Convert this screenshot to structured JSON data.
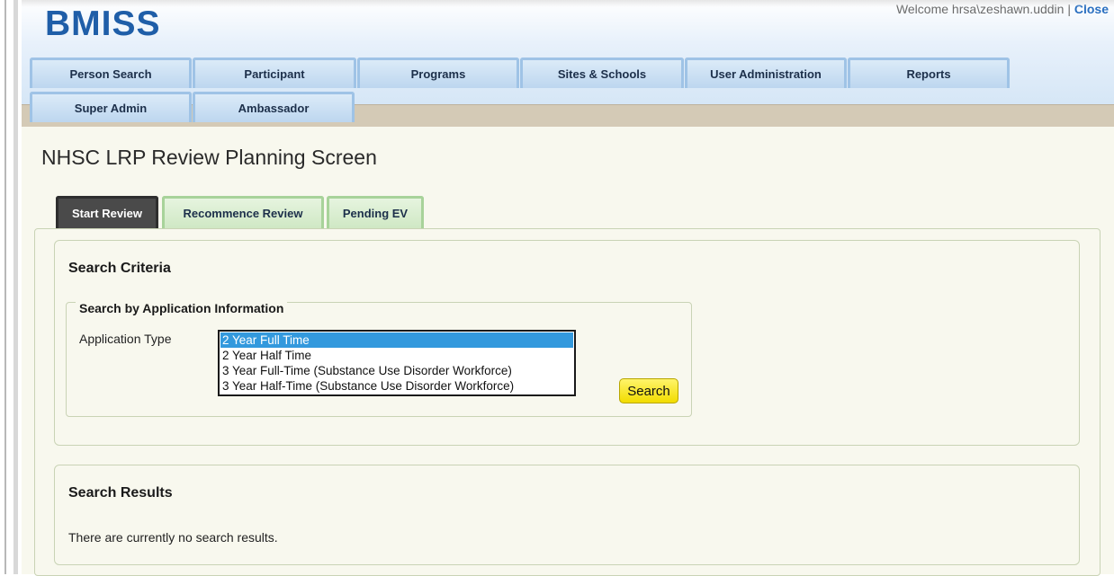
{
  "header": {
    "logo": "BMISS",
    "welcome_text": "Welcome hrsa\\zeshawn.uddin",
    "separator": "|",
    "close_label": "Close"
  },
  "nav": {
    "row1": [
      "Person Search",
      "Participant",
      "Programs",
      "Sites & Schools",
      "User Administration",
      "Reports"
    ],
    "row2": [
      "Super Admin",
      "Ambassador"
    ]
  },
  "page": {
    "title": "NHSC LRP Review Planning Screen"
  },
  "subtabs": [
    {
      "label": "Start Review",
      "active": true
    },
    {
      "label": "Recommence Review",
      "active": false
    },
    {
      "label": "Pending EV",
      "active": false
    }
  ],
  "search_criteria": {
    "title": "Search Criteria",
    "group_legend": "Search by Application Information",
    "field_label": "Application Type",
    "options": [
      "2 Year Full Time",
      "2 Year Half Time",
      "3 Year Full-Time (Substance Use Disorder Workforce)",
      "3 Year Half-Time (Substance Use Disorder Workforce)"
    ],
    "selected_option": "2 Year Full Time",
    "search_button": "Search"
  },
  "search_results": {
    "title": "Search Results",
    "empty_message": "There are currently no search results."
  },
  "colors": {
    "brand": "#1f5ea8",
    "search_button": "#f2dc00",
    "selection": "#3399dd",
    "active_tab": "#4a4a4a",
    "inactive_tab": "#cfe8c4"
  }
}
